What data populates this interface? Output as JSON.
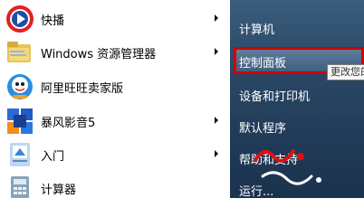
{
  "left_pane": {
    "items": [
      {
        "label": "快播",
        "icon": "kuaibo-icon",
        "has_submenu": true
      },
      {
        "label": "Windows 资源管理器",
        "icon": "folder-explorer-icon",
        "has_submenu": true
      },
      {
        "label": "阿里旺旺卖家版",
        "icon": "aliwangwang-icon",
        "has_submenu": false
      },
      {
        "label": "暴风影音5",
        "icon": "baofeng-icon",
        "has_submenu": true
      },
      {
        "label": "入门",
        "icon": "getting-started-icon",
        "has_submenu": true
      },
      {
        "label": "计算器",
        "icon": "calculator-icon",
        "has_submenu": false
      }
    ]
  },
  "right_pane": {
    "items": [
      {
        "label": "计算机"
      },
      {
        "label": "控制面板"
      },
      {
        "label": "设备和打印机"
      },
      {
        "label": "默认程序"
      },
      {
        "label": "帮助和支持"
      },
      {
        "label": "运行..."
      }
    ]
  },
  "tooltip": {
    "text": "更改您的计"
  },
  "colors": {
    "highlight_border": "#d10000",
    "right_pane": "#2b4a68"
  }
}
